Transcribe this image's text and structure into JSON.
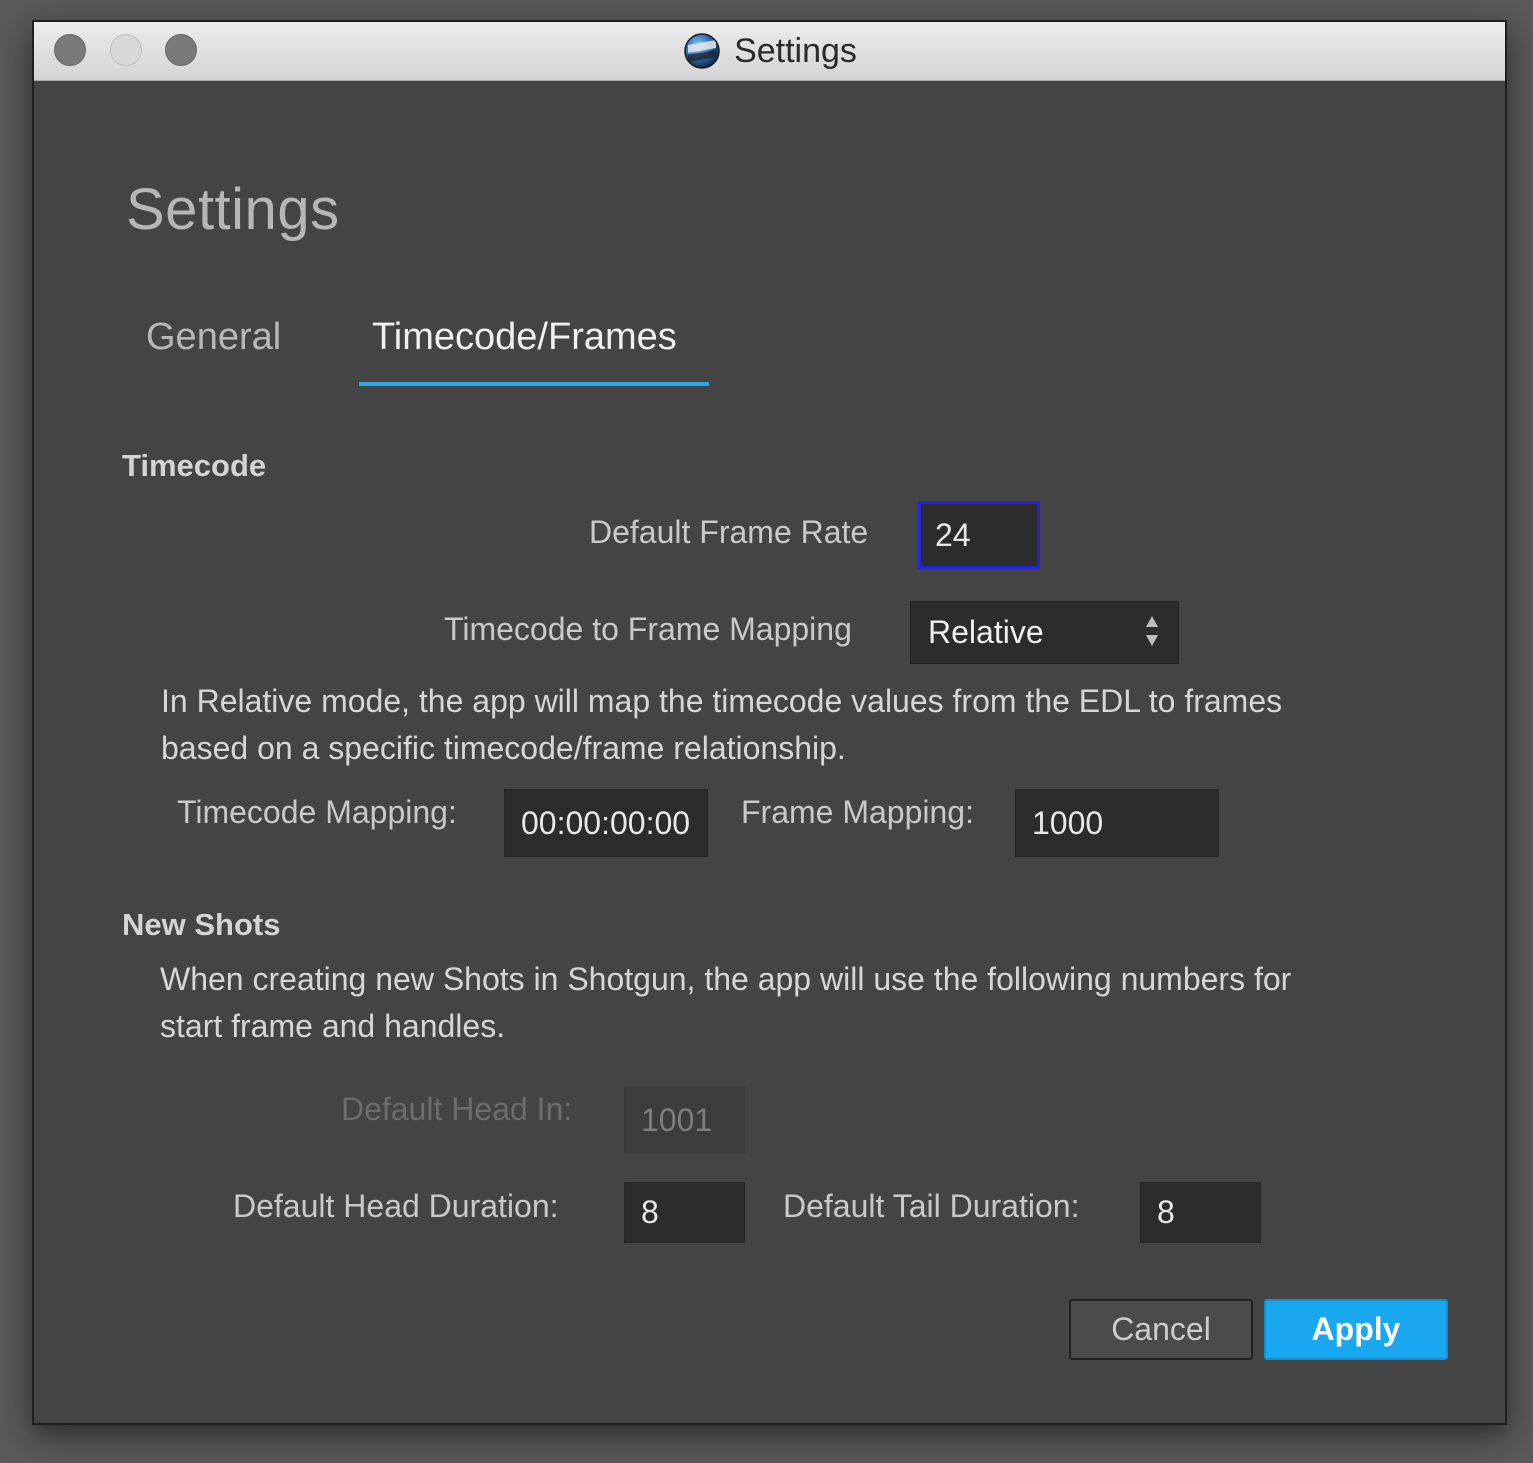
{
  "window": {
    "title": "Settings"
  },
  "page": {
    "heading": "Settings"
  },
  "tabs": [
    {
      "label": "General",
      "active": false
    },
    {
      "label": "Timecode/Frames",
      "active": true
    }
  ],
  "timecode_section": {
    "title": "Timecode",
    "default_frame_rate_label": "Default Frame Rate",
    "default_frame_rate_value": "24",
    "mapping_label": "Timecode to Frame Mapping",
    "mapping_value": "Relative",
    "description_line1": "In Relative mode, the app will map the timecode values from the EDL to frames",
    "description_line2": "based on a specific timecode/frame relationship.",
    "timecode_mapping_label": "Timecode Mapping:",
    "timecode_mapping_value": "00:00:00:00",
    "frame_mapping_label": "Frame Mapping:",
    "frame_mapping_value": "1000"
  },
  "new_shots_section": {
    "title": "New Shots",
    "description_line1": "When creating new Shots in Shotgun, the app will use the following numbers for",
    "description_line2": "start frame and handles.",
    "head_in_label": "Default Head In:",
    "head_in_value": "1001",
    "head_duration_label": "Default Head Duration:",
    "head_duration_value": "8",
    "tail_duration_label": "Default Tail Duration:",
    "tail_duration_value": "8"
  },
  "buttons": {
    "cancel": "Cancel",
    "apply": "Apply"
  },
  "colors": {
    "accent": "#2aa7e6",
    "apply_button": "#19a8f0",
    "focus_ring": "#2323e0",
    "background": "#444444"
  }
}
